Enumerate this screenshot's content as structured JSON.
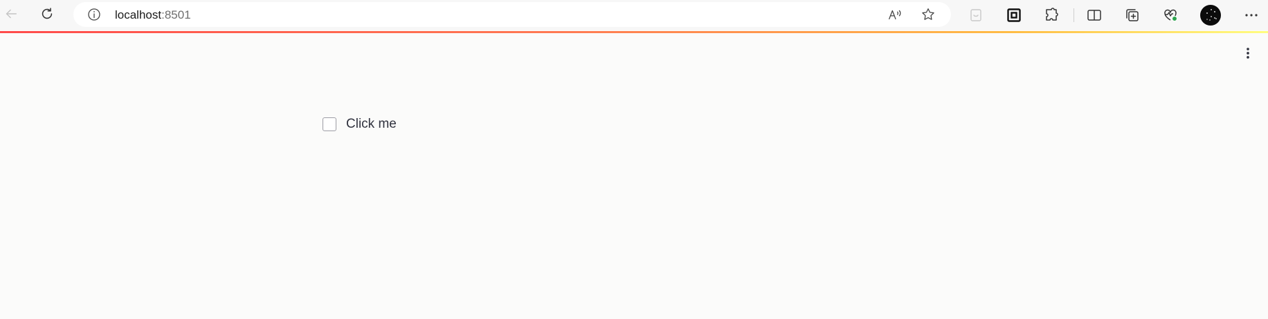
{
  "browser": {
    "url_host": "localhost",
    "url_port": ":8501",
    "back_icon": "arrow-left-icon",
    "refresh_icon": "refresh-icon",
    "site_info_icon": "info-icon",
    "read_aloud_icon": "read-aloud-icon",
    "favorite_icon": "star-icon",
    "toolbar_icons": [
      "app-icon",
      "collections-box-icon",
      "extensions-icon",
      "split-screen-icon",
      "collections-icon",
      "browser-essentials-icon",
      "profile-avatar",
      "more-icon"
    ]
  },
  "app": {
    "progress_colors": [
      "#ff4b4b",
      "#ffbd45",
      "#fffd80"
    ],
    "menu_icon": "vertical-dots-icon",
    "checkbox": {
      "label": "Click me",
      "checked": false
    }
  }
}
